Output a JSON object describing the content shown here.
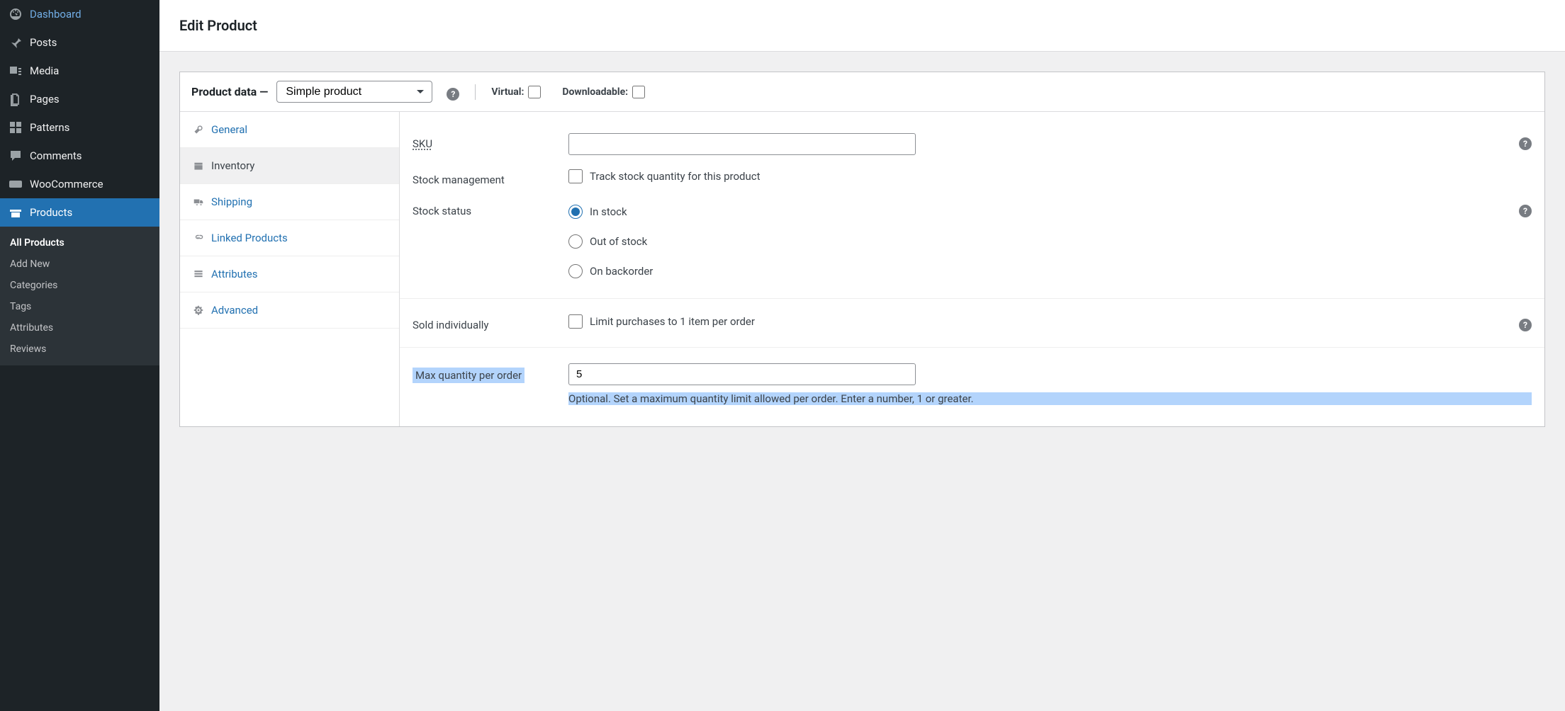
{
  "sidebar": {
    "items": [
      {
        "label": "Dashboard"
      },
      {
        "label": "Posts"
      },
      {
        "label": "Media"
      },
      {
        "label": "Pages"
      },
      {
        "label": "Patterns"
      },
      {
        "label": "Comments"
      },
      {
        "label": "WooCommerce"
      },
      {
        "label": "Products"
      }
    ],
    "sub": [
      {
        "label": "All Products"
      },
      {
        "label": "Add New"
      },
      {
        "label": "Categories"
      },
      {
        "label": "Tags"
      },
      {
        "label": "Attributes"
      },
      {
        "label": "Reviews"
      }
    ]
  },
  "page": {
    "title": "Edit Product"
  },
  "panel": {
    "title": "Product data —",
    "product_type_selected": "Simple product",
    "virtual": {
      "label": "Virtual:",
      "checked": false
    },
    "downloadable": {
      "label": "Downloadable:",
      "checked": false
    }
  },
  "tabs": {
    "items": [
      {
        "label": "General"
      },
      {
        "label": "Inventory"
      },
      {
        "label": "Shipping"
      },
      {
        "label": "Linked Products"
      },
      {
        "label": "Attributes"
      },
      {
        "label": "Advanced"
      }
    ],
    "active_index": 1
  },
  "form": {
    "sku": {
      "label": "SKU",
      "value": ""
    },
    "stock_management": {
      "label": "Stock management",
      "checkbox_label": "Track stock quantity for this product",
      "checked": false
    },
    "stock_status": {
      "label": "Stock status",
      "options": [
        {
          "label": "In stock",
          "value": "instock"
        },
        {
          "label": "Out of stock",
          "value": "outofstock"
        },
        {
          "label": "On backorder",
          "value": "onbackorder"
        }
      ],
      "selected": "instock"
    },
    "sold_individually": {
      "label": "Sold individually",
      "checkbox_label": "Limit purchases to 1 item per order",
      "checked": false
    },
    "max_qty": {
      "label": "Max quantity per order",
      "value": "5",
      "help": "Optional. Set a maximum quantity limit allowed per order. Enter a number, 1 or greater."
    }
  }
}
